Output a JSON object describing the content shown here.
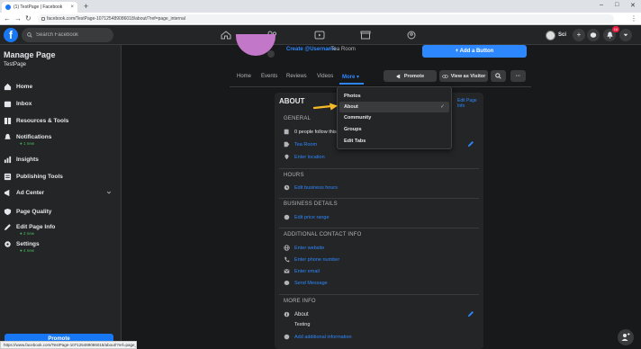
{
  "browser": {
    "tab_title": "(1) TestPage | Facebook",
    "tab_close": "×",
    "new_tab": "+",
    "window_controls": [
      "–",
      "□",
      "✕"
    ],
    "url": "facebook.com/TestPage-107125489086018/about/?ref=page_internal",
    "status_url": "https://www.facebook.com/TestPage-107125489086018/about/?ref=page_internal"
  },
  "fbnav": {
    "logo": "f",
    "search_placeholder": "Search Facebook",
    "user_name": "Sci",
    "plus": "+",
    "notif_count": "10"
  },
  "sidebar": {
    "title": "Manage Page",
    "subtitle": "TestPage",
    "items": [
      {
        "label": "Home",
        "icon": "home-icon"
      },
      {
        "label": "Inbox",
        "icon": "inbox-icon"
      },
      {
        "label": "Resources & Tools",
        "icon": "resources-icon"
      },
      {
        "label": "Notifications",
        "icon": "bell-icon",
        "note": "● 1 new"
      },
      {
        "label": "Insights",
        "icon": "insights-icon"
      },
      {
        "label": "Publishing Tools",
        "icon": "publishing-icon"
      },
      {
        "label": "Ad Center",
        "icon": "ad-center-icon"
      },
      {
        "label": "Page Quality",
        "icon": "shield-icon"
      },
      {
        "label": "Edit Page Info",
        "icon": "pencil-icon",
        "note": "● 2 new"
      },
      {
        "label": "Settings",
        "icon": "gear-icon",
        "note": "● 4 new"
      }
    ],
    "promote": "Promote"
  },
  "header": {
    "create_username": "Create @Username",
    "category": "· Tea Room",
    "add_button": "+ Add a Button",
    "tabs": [
      "Home",
      "Events",
      "Reviews",
      "Videos"
    ],
    "more_tab": "More ▾",
    "promote": "Promote",
    "view_as_visitor": "View as Visitor",
    "ellipsis": "···"
  },
  "dropdown": {
    "items": [
      "Photos",
      "About",
      "Community",
      "Groups",
      "Edit Tabs"
    ],
    "selected": "About",
    "check": "✓"
  },
  "about": {
    "title": "ABOUT",
    "edit_page_info": "Edit Page Info",
    "general": "GENERAL",
    "people_follow": "0 people follow this",
    "category_link": "Tea Room",
    "enter_location": "Enter location",
    "hours": "HOURS",
    "edit_business_hours": "Edit business hours",
    "business_details": "BUSINESS DETAILS",
    "edit_price_range": "Edit price range",
    "additional_contact": "ADDITIONAL CONTACT INFO",
    "enter_website": "Enter website",
    "enter_phone": "Enter phone number",
    "enter_email": "Enter email",
    "send_message": "Send Message",
    "more_info": "MORE INFO",
    "about_label": "About",
    "about_value": "Testing",
    "add_additional": "Add additional information"
  },
  "colors": {
    "accent": "#2d88ff",
    "background": "#18191a",
    "card": "#242526",
    "arrow": "#f7b928"
  }
}
